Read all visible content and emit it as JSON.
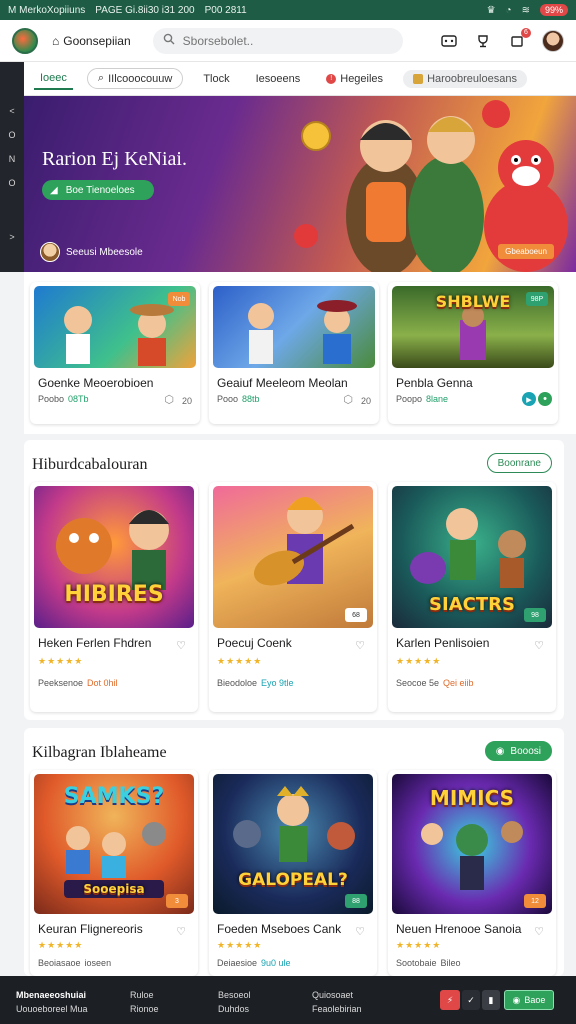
{
  "status_bar": {
    "carrier": "M MerkoXopiiuns",
    "info": "PAGE Gi.8ii30 i31 200",
    "extra": "P00 2811",
    "battery": "99%"
  },
  "header": {
    "brand": "Goonsepiian",
    "search_placeholder": "Sborsebolet..",
    "notification_count": "6"
  },
  "rail": {
    "items": [
      "<",
      "O",
      "N",
      "O",
      ">"
    ]
  },
  "tabs": [
    {
      "label": "Ioeec",
      "style": "active"
    },
    {
      "label": "IIlcooocouuw",
      "style": "pill"
    },
    {
      "label": "Tlock",
      "style": "plain"
    },
    {
      "label": "Iesoeens",
      "style": "plain"
    },
    {
      "label": "Hegeiles",
      "style": "badge"
    },
    {
      "label": "Haroobreuloesans",
      "style": "gray"
    }
  ],
  "hero": {
    "title": "Rarion Ej KeNiai.",
    "button_label": "Boe Tienoeloes",
    "user_name": "Seeusi Mbeesole",
    "tag": "Gbeaboeun"
  },
  "top_row": [
    {
      "title": "Goenke Meoerobioen",
      "meta": "Poobo",
      "meta_accent": "08Tb",
      "count": "20",
      "tag": "Nob"
    },
    {
      "title": "Geaiuf Meeleom Meolan",
      "meta": "Pooo",
      "meta_accent": "88tb",
      "count": "20",
      "tag": ""
    },
    {
      "title": "Penbla Genna",
      "meta": "Poopo",
      "meta_accent": "8lane",
      "count": "",
      "tag": "98P",
      "thumb_text": "SHBLWE"
    }
  ],
  "section_a": {
    "title": "Hiburdcabalouran",
    "button": "Boonrane",
    "cards": [
      {
        "title": "Heken Ferlen Fhdren",
        "meta": "Peeksenoe",
        "meta_accent": "Dot 0hil",
        "thumb_text": "HIBIRES",
        "tag": ""
      },
      {
        "title": "Poecuj Coenk",
        "meta": "Bieodoloe",
        "meta_accent": "Eyo 9tle",
        "thumb_text": "",
        "tag": "68"
      },
      {
        "title": "Karlen Penlisoien",
        "meta": "Seocoe 5e",
        "meta_accent": "Qei eiib",
        "thumb_text": "SIACTRS",
        "tag": "98"
      }
    ]
  },
  "section_b": {
    "title": "Kilbagran Iblaheame",
    "button": "Booosi",
    "cards": [
      {
        "title": "Keuran Flignereoris",
        "meta": "Beoiasaoe",
        "meta_accent": "ioseen",
        "thumb_text": "SAMKS?",
        "thumb_sub": "Sooepisa",
        "tag": "3"
      },
      {
        "title": "Foeden Mseboes Cank",
        "meta": "Deiaesioe",
        "meta_accent": "9u0 ule",
        "thumb_text": "GALOPEAL?",
        "tag": "88"
      },
      {
        "title": "Neuen Hrenooe Sanoia",
        "meta": "Sootobaie",
        "meta_accent": "Bileo",
        "thumb_text": "MIMICS",
        "tag": "12"
      }
    ]
  },
  "footer": {
    "col1": [
      "Mbenaeeoshuiai",
      "Uouoeboreel Mua"
    ],
    "col2": [
      "Ruloe",
      "Rionoe"
    ],
    "col3": [
      "Besoeol",
      "Duhdos"
    ],
    "col4": [
      "Quiosoaet",
      "Feaolebirian"
    ],
    "cta": "Baoe"
  },
  "colors": {
    "brand_green": "#2ea15a",
    "status_bar": "#1f5c46",
    "footer": "#1c1f24",
    "alert_red": "#e04848"
  }
}
